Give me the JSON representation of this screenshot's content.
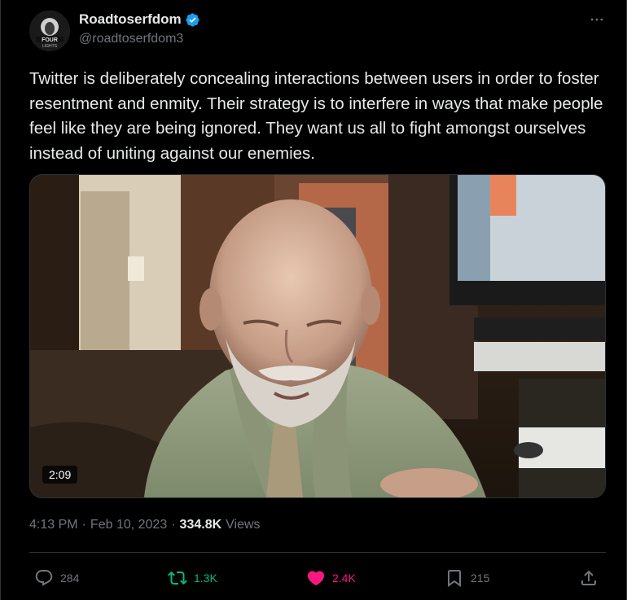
{
  "author": {
    "display_name": "Roadtoserfdom",
    "handle": "@roadtoserfdom3",
    "avatar_text": "FOUR LIGHTS"
  },
  "tweet": {
    "text": "Twitter is deliberately concealing interactions between users in order to foster resentment and enmity. Their strategy is to interfere in ways that make people feel like they are being ignored. They want us all to fight amongst ourselves instead of uniting against our enemies."
  },
  "media": {
    "duration": "2:09"
  },
  "meta": {
    "time": "4:13 PM",
    "separator1": "·",
    "date": "Feb 10, 2023",
    "separator2": "·",
    "views_count": "334.8K",
    "views_label": "Views"
  },
  "actions": {
    "replies": "284",
    "reposts": "1.3K",
    "likes": "2.4K",
    "bookmarks": "215"
  },
  "colors": {
    "accent_blue": "#1d9bf0",
    "repost_green": "#00ba7c",
    "like_pink": "#f91880",
    "muted": "#71767b"
  }
}
